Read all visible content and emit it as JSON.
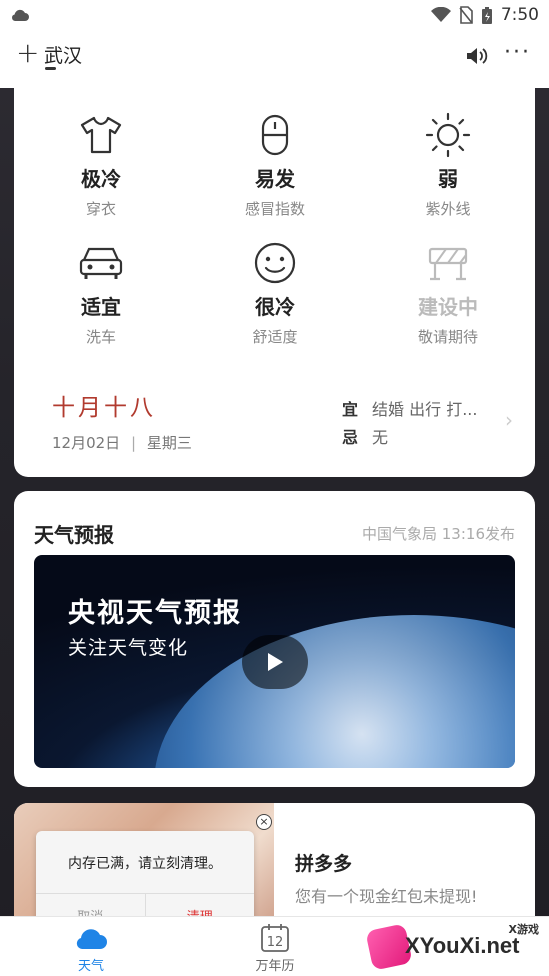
{
  "status_bar": {
    "time": "7:50"
  },
  "header": {
    "add_symbol": "+",
    "city": "武汉"
  },
  "life_index": [
    {
      "value": "极冷",
      "label": "穿衣",
      "icon": "tshirt-icon"
    },
    {
      "value": "易发",
      "label": "感冒指数",
      "icon": "pill-icon"
    },
    {
      "value": "弱",
      "label": "紫外线",
      "icon": "sun-icon"
    },
    {
      "value": "适宜",
      "label": "洗车",
      "icon": "car-icon"
    },
    {
      "value": "很冷",
      "label": "舒适度",
      "icon": "smiley-icon"
    },
    {
      "value": "建设中",
      "label": "敬请期待",
      "icon": "barrier-icon"
    }
  ],
  "calendar": {
    "lunar_date": "十月十八",
    "solar_date": "12月02日",
    "separator": "|",
    "weekday": "星期三",
    "yi_label": "宜",
    "yi_text": "结婚 出行 打...",
    "ji_label": "忌",
    "ji_text": "无"
  },
  "forecast": {
    "title": "天气预报",
    "source": "中国气象局 13:16发布",
    "video_title": "央视天气预报",
    "video_subtitle": "关注天气变化"
  },
  "ad": {
    "popup_message": "内存已满，请立刻清理。",
    "popup_cancel": "取消",
    "popup_confirm": "清理",
    "title": "拼多多",
    "description": "您有一个现金红包未提现!"
  },
  "tabs": [
    {
      "label": "天气",
      "active": true
    },
    {
      "label": "万年历",
      "active": false
    }
  ],
  "watermark": {
    "text": "XYouXi.net",
    "small": "X游戏"
  },
  "colors": {
    "accent": "#1f84e6",
    "lunar": "#b13a2e",
    "confirm": "#dd3333"
  }
}
